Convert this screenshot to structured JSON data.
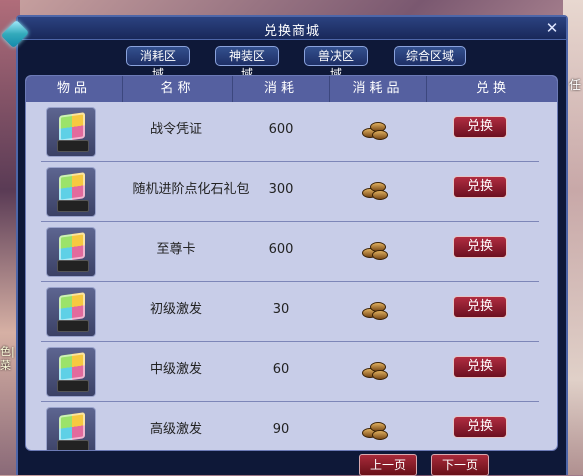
{
  "window": {
    "title": "兑换商城",
    "close_label": "✕"
  },
  "tabs": [
    "消耗区域",
    "神装区域",
    "兽决区域",
    "综合区域"
  ],
  "columns": [
    "物品",
    "名称",
    "消耗",
    "消耗品",
    "兑换"
  ],
  "items": [
    {
      "name": "战令凭证",
      "cost": "600",
      "button": "兑换"
    },
    {
      "name": "随机进阶点化石礼包",
      "cost": "300",
      "button": "兑换"
    },
    {
      "name": "至尊卡",
      "cost": "600",
      "button": "兑换"
    },
    {
      "name": "初级激发",
      "cost": "30",
      "button": "兑换"
    },
    {
      "name": "中级激发",
      "cost": "60",
      "button": "兑换"
    },
    {
      "name": "高级激发",
      "cost": "90",
      "button": "兑换"
    }
  ],
  "pagination": {
    "prev_label": "上一页",
    "next_label": "下一页"
  },
  "background": {
    "right_text": "任",
    "left_text": "色|菜"
  },
  "colors": {
    "window_bg": "#0e1838",
    "panel_bg": "#c8cde8",
    "header_bg": "#5560a0",
    "button_red": "#8c1c2c"
  },
  "icons": {
    "item": "rainbow-cube-icon",
    "currency": "coin-pile-icon",
    "corner": "gem-icon"
  }
}
